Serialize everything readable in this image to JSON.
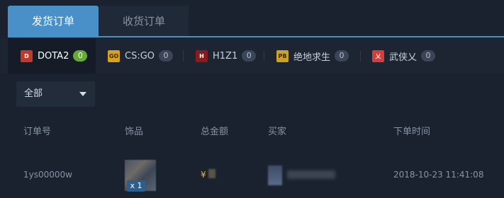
{
  "tabs": {
    "send_orders": "发货订单",
    "receive_orders": "收货订单"
  },
  "games": [
    {
      "label": "DOTA2",
      "count": "0",
      "icon": "dota2-icon",
      "icon_text": "D",
      "color": "#c0392b"
    },
    {
      "label": "CS:GO",
      "count": "0",
      "icon": "csgo-icon",
      "icon_text": "GO",
      "color": "#d9a21b"
    },
    {
      "label": "H1Z1",
      "count": "0",
      "icon": "h1z1-icon",
      "icon_text": "H",
      "color": "#8b1a1a"
    },
    {
      "label": "绝地求生",
      "count": "0",
      "icon": "pubg-icon",
      "icon_text": "PB",
      "color": "#c9a227"
    },
    {
      "label": "武侠乂",
      "count": "0",
      "icon": "wuxia-icon",
      "icon_text": "乂",
      "color": "#d63c3c"
    }
  ],
  "filter": {
    "selected": "全部"
  },
  "table": {
    "headers": [
      "订单号",
      "饰品",
      "总金额",
      "买家",
      "下单时间"
    ],
    "rows": [
      {
        "order_id": "1ys00000w",
        "quantity": "x 1",
        "currency": "¥",
        "order_time": "2018-10-23 11:41:08"
      }
    ]
  }
}
